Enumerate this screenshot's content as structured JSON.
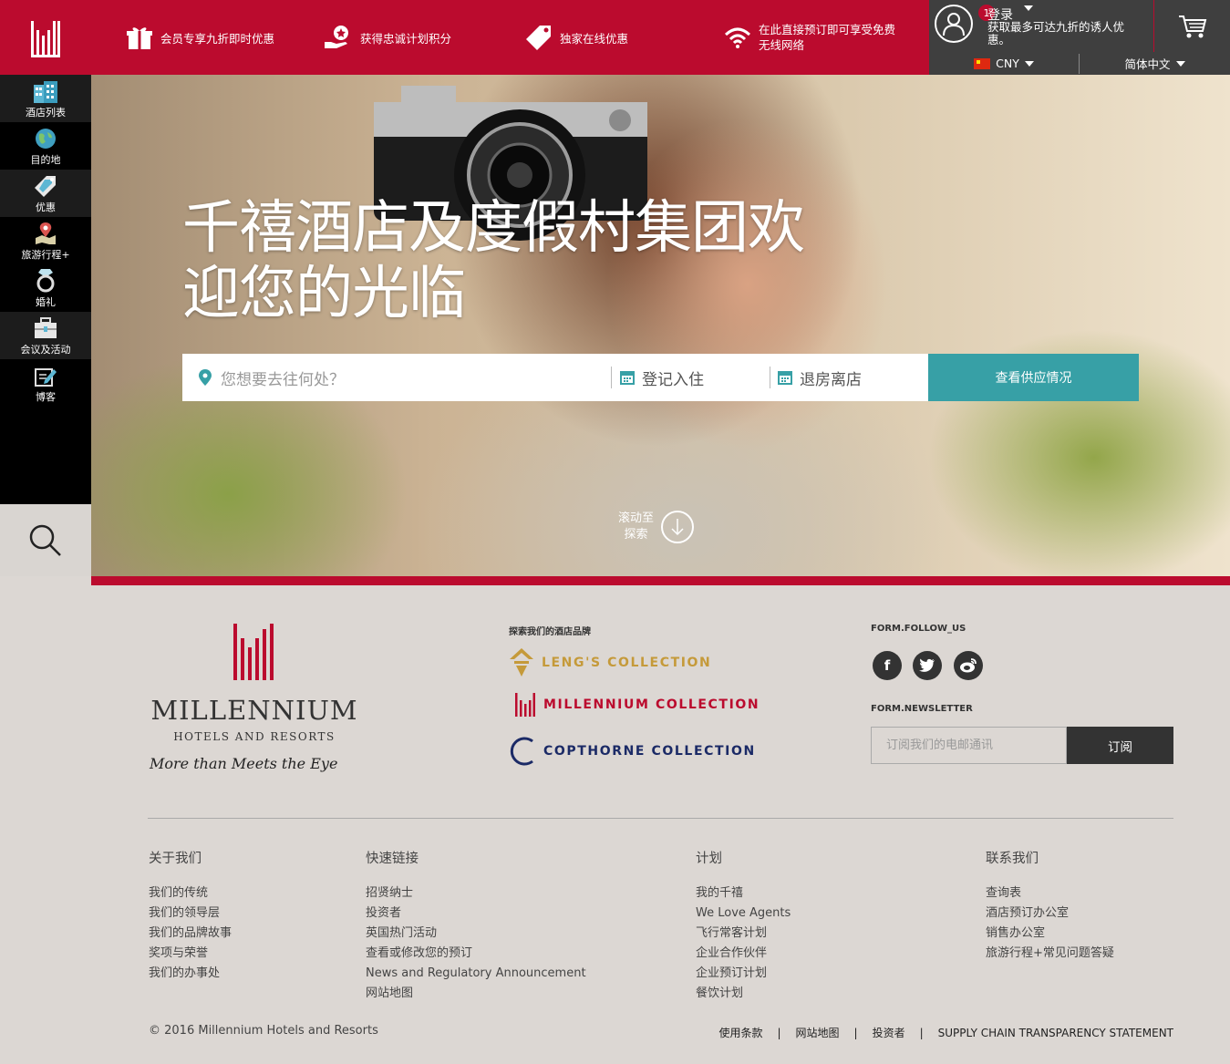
{
  "topbar": {
    "perks": [
      {
        "label": "会员专享九折即时优惠",
        "icon": "gift-icon"
      },
      {
        "label": "获得忠诚计划积分",
        "icon": "loyalty-hand-icon"
      },
      {
        "label": "独家在线优惠",
        "icon": "tag-icon"
      },
      {
        "label_line1": "在此直接预订即可享受免费",
        "label_line2": "无线网络",
        "icon": "wifi-icon"
      }
    ],
    "account": {
      "login": "登录",
      "badge": "1",
      "subtitle": "获取最多可达九折的诱人优惠。"
    },
    "currency": "CNY",
    "language": "简体中文"
  },
  "sidenav": {
    "items": [
      {
        "label": "酒店列表",
        "icon": "hotel-building-icon"
      },
      {
        "label": "目的地",
        "icon": "globe-icon"
      },
      {
        "label": "优惠",
        "icon": "tag-icon"
      },
      {
        "label": "旅游行程+",
        "icon": "map-pin-icon"
      },
      {
        "label": "婚礼",
        "icon": "ring-icon"
      },
      {
        "label": "会议及活动",
        "icon": "briefcase-icon"
      },
      {
        "label": "博客",
        "icon": "edit-icon"
      }
    ],
    "search_icon": "search-icon"
  },
  "hero": {
    "title_line1": "千禧酒店及度假村集团欢",
    "title_line2": "迎您的光临",
    "destination_placeholder": "您想要去往何处？",
    "checkin": "登记入住",
    "checkout": "退房离店",
    "cta": "查看供应情况",
    "scroll_line1": "滚动至",
    "scroll_line2": "探索"
  },
  "footer": {
    "brand": {
      "name": "MILLENNIUM",
      "sub": "HOTELS AND RESORTS",
      "tagline": "More than Meets the Eye"
    },
    "brands_heading": "探索我们的酒店品牌",
    "collections": [
      "LENG'S COLLECTION",
      "MILLENNIUM COLLECTION",
      "COPTHORNE COLLECTION"
    ],
    "follow_heading": "FORM.FOLLOW_US",
    "social": [
      "f",
      "t",
      "w"
    ],
    "newsletter_heading": "FORM.NEWSLETTER",
    "newsletter_placeholder": "订阅我们的电邮通讯",
    "subscribe": "订阅",
    "columns": [
      {
        "title": "关于我们",
        "links": [
          "我们的传统",
          "我们的领导层",
          "我们的品牌故事",
          "奖项与荣誉",
          "我们的办事处"
        ]
      },
      {
        "title": "快速链接",
        "links": [
          "招贤纳士",
          "投资者",
          "英国热门活动",
          "查看或修改您的预订",
          "News and Regulatory Announcement",
          "网站地图"
        ]
      },
      {
        "title": "计划",
        "links": [
          "我的千禧",
          "We Love Agents",
          "飞行常客计划",
          "企业合作伙伴",
          "企业预订计划",
          "餐饮计划"
        ]
      },
      {
        "title": "联系我们",
        "links": [
          "查询表",
          "酒店预订办公室",
          "销售办公室",
          "旅游行程+常见问题答疑"
        ]
      }
    ],
    "copyright": "© 2016 Millennium Hotels and Resorts",
    "legal": [
      "使用条款",
      "网站地图",
      "投资者",
      "SUPPLY CHAIN TRANSPARENCY STATEMENT"
    ]
  },
  "colors": {
    "brand_red": "#bb0b2e",
    "teal": "#37a0a6",
    "dark": "#3f3f3f",
    "footer_bg": "#dcd7d3",
    "lengs_gold": "#c59a3a",
    "copthorne_navy": "#1b2a66"
  }
}
